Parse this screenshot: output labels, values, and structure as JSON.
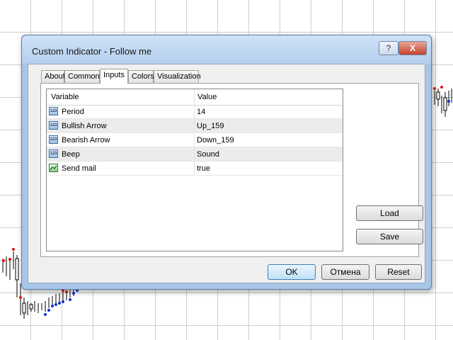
{
  "window": {
    "title": "Custom Indicator - Follow me",
    "help_label": "?",
    "close_label": "X"
  },
  "tabs": [
    {
      "label": "About"
    },
    {
      "label": "Common"
    },
    {
      "label": "Inputs"
    },
    {
      "label": "Colors"
    },
    {
      "label": "Visualization"
    }
  ],
  "active_tab": "Inputs",
  "grid": {
    "columns": [
      "Variable",
      "Value"
    ],
    "rows": [
      {
        "icon": "numeric-param-icon",
        "variable": "Period",
        "value": "14"
      },
      {
        "icon": "numeric-param-icon",
        "variable": "Bullish Arrow",
        "value": "Up_159"
      },
      {
        "icon": "numeric-param-icon",
        "variable": "Bearish Arrow",
        "value": "Down_159"
      },
      {
        "icon": "numeric-param-icon",
        "variable": "Beep",
        "value": "Sound"
      },
      {
        "icon": "bool-param-icon",
        "variable": "Send mail",
        "value": "true"
      }
    ]
  },
  "buttons": {
    "load": "Load",
    "save": "Save",
    "ok": "OK",
    "cancel": "Отмена",
    "reset": "Reset"
  },
  "icon_text": "123",
  "colors": {
    "window_frame": "#a8c6e6",
    "bull_marker": "#1030d0",
    "bear_marker": "#e01010"
  }
}
